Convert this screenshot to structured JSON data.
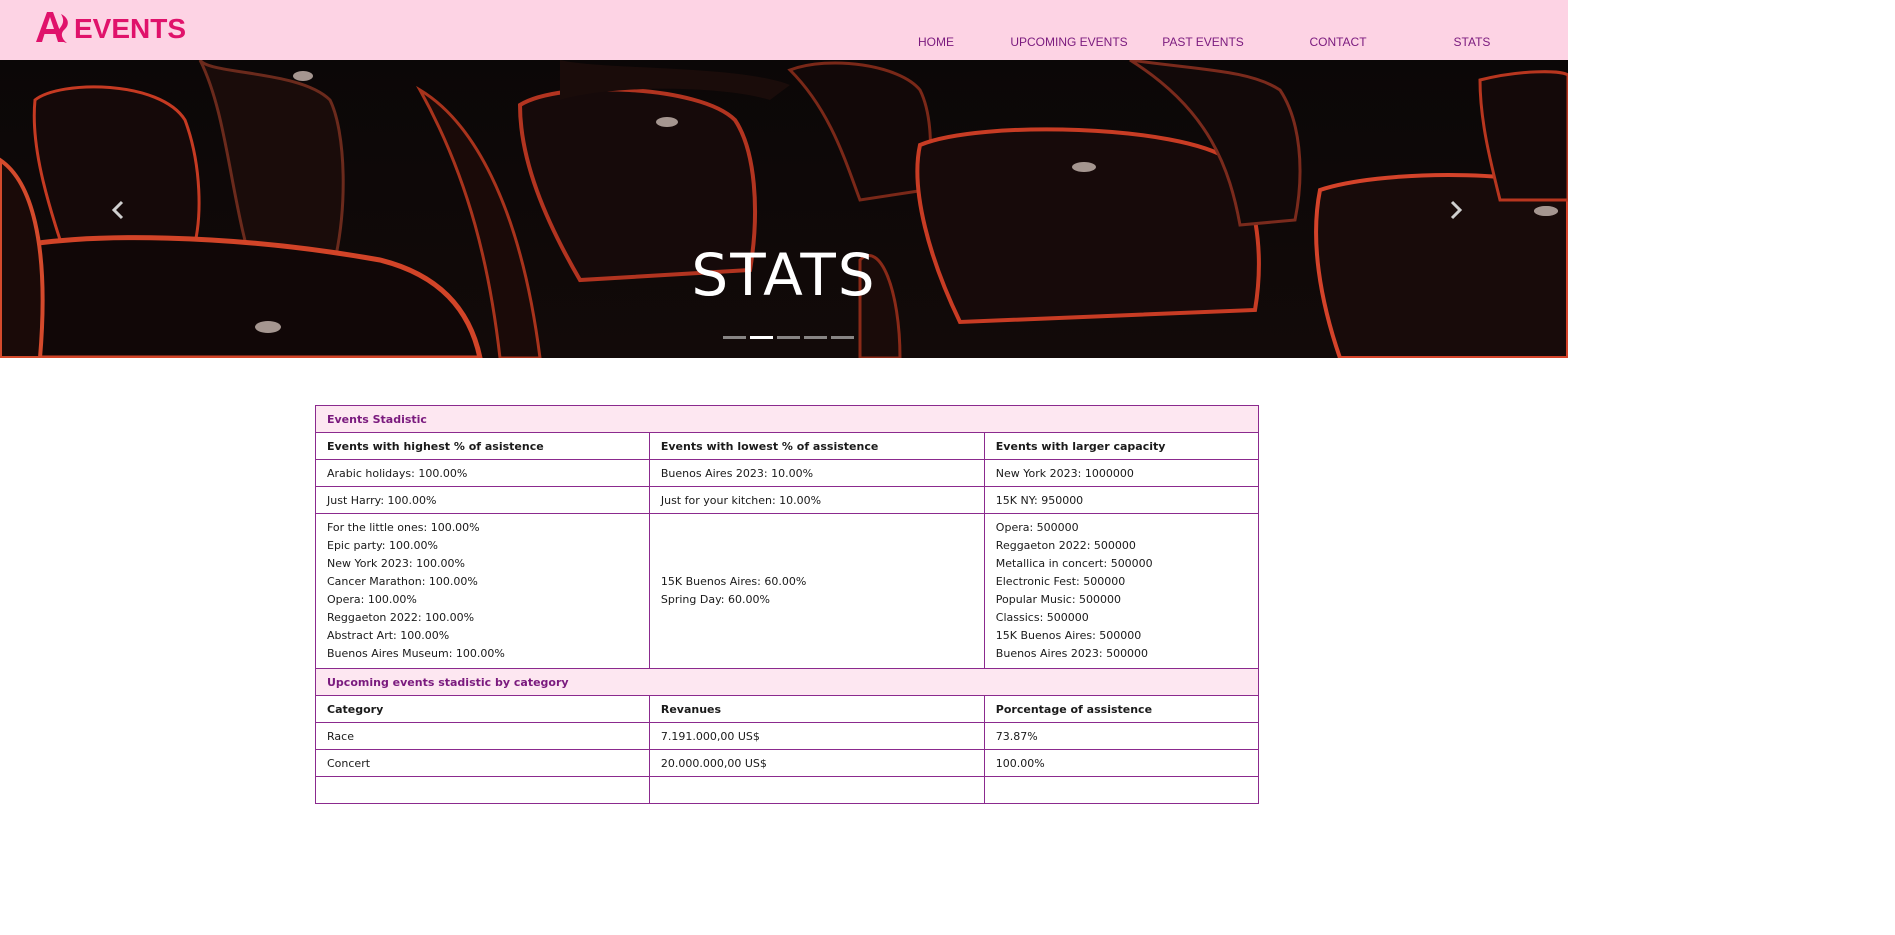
{
  "brand": {
    "logo_text": "ASEVENTS",
    "logo_color": "#e0126b"
  },
  "nav": {
    "items": [
      "HOME",
      "UPCOMING EVENTS",
      "PAST EVENTS",
      "CONTACT",
      "STATS"
    ]
  },
  "hero": {
    "title": "STATS",
    "slide_count": 5,
    "active_slide": 2,
    "prev_icon": "chevron-left-icon",
    "next_icon": "chevron-right-icon"
  },
  "table": {
    "section1_title": "Events Stadistic",
    "section1_headers": [
      "Events with highest % of asistence",
      "Events with lowest % of assistence",
      "Events with larger capacity"
    ],
    "section1_rows": [
      [
        "Arabic holidays: 100.00%",
        "Buenos Aires 2023: 10.00%",
        "New York 2023: 1000000"
      ],
      [
        "Just Harry: 100.00%",
        "Just for your kitchen: 10.00%",
        "15K NY: 950000"
      ]
    ],
    "section1_multi": {
      "col1": [
        "For the little ones: 100.00%",
        "Epic party: 100.00%",
        "New York 2023: 100.00%",
        "Cancer Marathon: 100.00%",
        "Opera: 100.00%",
        "Reggaeton 2022: 100.00%",
        "Abstract Art: 100.00%",
        "Buenos Aires Museum: 100.00%"
      ],
      "col2": [
        "15K Buenos Aires: 60.00%",
        "Spring Day: 60.00%"
      ],
      "col3": [
        "Opera: 500000",
        "Reggaeton 2022: 500000",
        "Metallica in concert: 500000",
        "Electronic Fest: 500000",
        "Popular Music: 500000",
        "Classics: 500000",
        "15K Buenos Aires: 500000",
        "Buenos Aires 2023: 500000"
      ]
    },
    "section2_title": "Upcoming events stadistic by category",
    "section2_headers": [
      "Category",
      "Revanues",
      "Porcentage of assistence"
    ],
    "section2_rows": [
      [
        "Race",
        "7.191.000,00 US$",
        "73.87%"
      ],
      [
        "Concert",
        "20.000.000,00 US$",
        "100.00%"
      ]
    ]
  }
}
